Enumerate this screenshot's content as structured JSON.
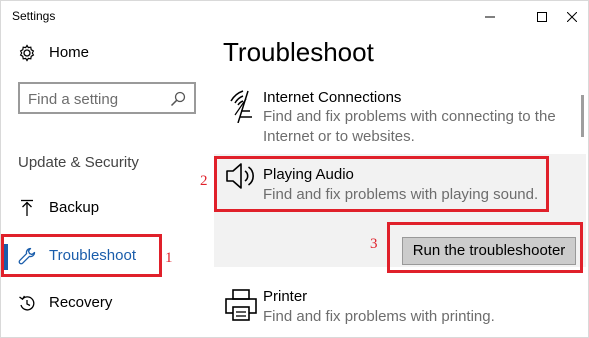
{
  "window": {
    "title": "Settings"
  },
  "sidebar": {
    "home_label": "Home",
    "search_placeholder": "Find a setting",
    "section_label": "Update & Security",
    "items": [
      {
        "label": "Backup",
        "icon": "arrow-up-icon"
      },
      {
        "label": "Troubleshoot",
        "icon": "wrench-icon",
        "selected": true
      },
      {
        "label": "Recovery",
        "icon": "recovery-icon"
      }
    ]
  },
  "main": {
    "title": "Troubleshoot",
    "items": [
      {
        "name": "Internet Connections",
        "description": "Find and fix problems with connecting to the Internet or to websites.",
        "icon": "wifi-icon"
      },
      {
        "name": "Playing Audio",
        "description": "Find and fix problems with playing sound.",
        "icon": "speaker-icon",
        "expanded": true,
        "button_label": "Run the troubleshooter"
      },
      {
        "name": "Printer",
        "description": "Find and fix problems with printing.",
        "icon": "printer-icon"
      }
    ]
  },
  "annotations": {
    "step1": "1",
    "step2": "2",
    "step3": "3",
    "color": "#e0202a"
  },
  "colors": {
    "accent": "#1a5dab",
    "selected_item_bg": "#f2f2f2",
    "button_bg": "#cccccc"
  }
}
